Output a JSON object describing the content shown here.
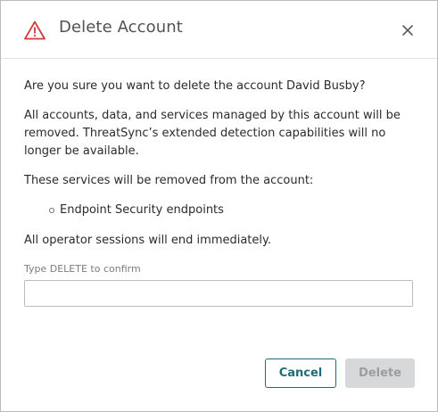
{
  "dialog": {
    "title": "Delete Account",
    "icons": {
      "warning": "warning-triangle-icon",
      "close": "close-icon"
    },
    "colors": {
      "warning": "#d33a3a",
      "primary": "#1f6b79",
      "disabled_bg": "#d6d8da",
      "disabled_text": "#9a9ea2"
    },
    "question": "Are you sure you want to delete the account David Busby?",
    "warning_text": "All accounts, data, and services managed by this account will be removed. ThreatSync’s extended detection capabilities will no longer be available.",
    "services_intro": "These services will be removed from the account:",
    "services": [
      "Endpoint Security endpoints"
    ],
    "sessions_note": "All operator sessions will end immediately.",
    "confirm_label": "Type DELETE to confirm",
    "confirm_value": "",
    "cancel_label": "Cancel",
    "delete_label": "Delete"
  }
}
